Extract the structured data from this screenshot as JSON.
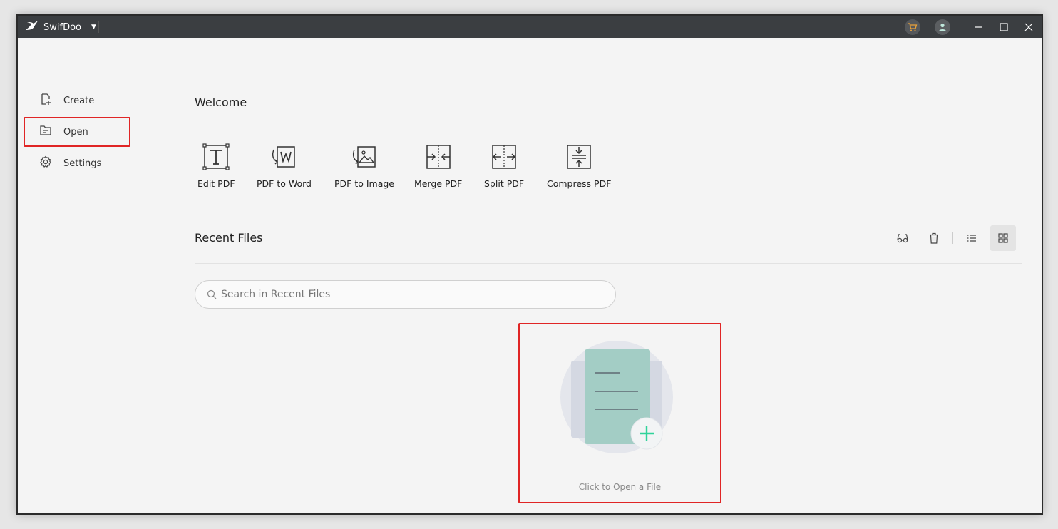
{
  "titlebar": {
    "app_name": "SwifDoo",
    "icons": [
      "swift-bird-icon",
      "cart-icon",
      "user-icon",
      "minimize-icon",
      "maximize-icon",
      "close-icon"
    ]
  },
  "sidebar": {
    "items": [
      {
        "label": "Create",
        "icon": "create-file-icon"
      },
      {
        "label": "Open",
        "icon": "open-folder-icon"
      },
      {
        "label": "Settings",
        "icon": "gear-icon"
      }
    ]
  },
  "main": {
    "welcome": "Welcome",
    "tools": [
      {
        "label": "Edit PDF",
        "icon": "edit-text-icon"
      },
      {
        "label": "PDF to Word",
        "icon": "pdf-to-word-icon"
      },
      {
        "label": "PDF to Image",
        "icon": "pdf-to-image-icon"
      },
      {
        "label": "Merge PDF",
        "icon": "merge-icon"
      },
      {
        "label": "Split PDF",
        "icon": "split-icon"
      },
      {
        "label": "Compress PDF",
        "icon": "compress-icon"
      }
    ],
    "recent_title": "Recent Files",
    "recent_actions": [
      "glasses-icon",
      "trash-icon",
      "list-view-icon",
      "grid-view-icon"
    ],
    "search_placeholder": "Search in Recent Files",
    "open_file_text": "Click to Open a File"
  },
  "colors": {
    "titlebar_bg": "#3b3e41",
    "highlight_border": "#e02525",
    "accent_green": "#2fd39a",
    "doc_teal": "#a3cdc5",
    "cart_orange": "#e9a23b"
  }
}
